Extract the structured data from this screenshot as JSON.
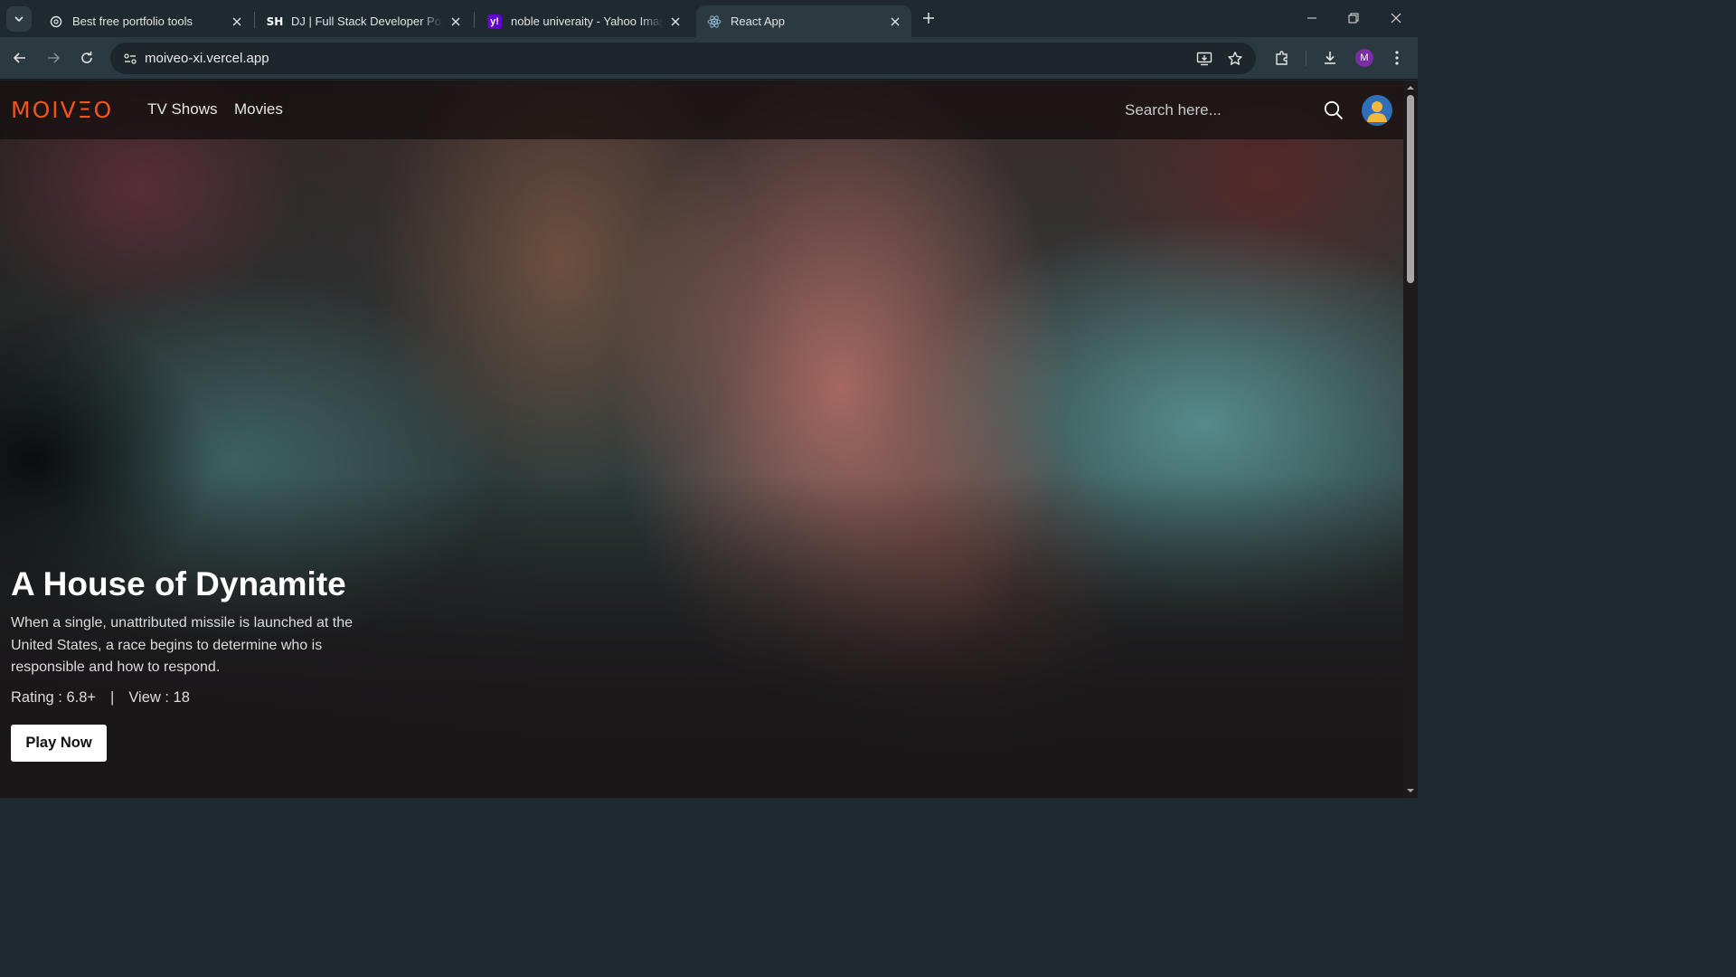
{
  "browser": {
    "tabs": [
      {
        "title": "Best free portfolio tools",
        "favicon": "openai-icon"
      },
      {
        "title": "DJ | Full Stack Developer Portfolio",
        "favicon": "sh-logo-icon"
      },
      {
        "title": "noble univeraity - Yahoo Images",
        "favicon": "yahoo-icon"
      },
      {
        "title": "React App",
        "favicon": "react-icon",
        "active": true
      }
    ],
    "url": "moiveo-xi.vercel.app",
    "profile_initial": "M"
  },
  "site": {
    "logo": "MOIVΞO",
    "brand_color": "#f2541b",
    "nav": [
      "TV Shows",
      "Movies"
    ],
    "search_placeholder": "Search here..."
  },
  "hero": {
    "title": "A House of Dynamite",
    "description": "When a single, unattributed missile is launched at the United States, a race begins to determine who is responsible and how to respond.",
    "rating": "Rating : 6.8+",
    "separator": "|",
    "views": "View : 18",
    "play_label": "Play Now"
  }
}
